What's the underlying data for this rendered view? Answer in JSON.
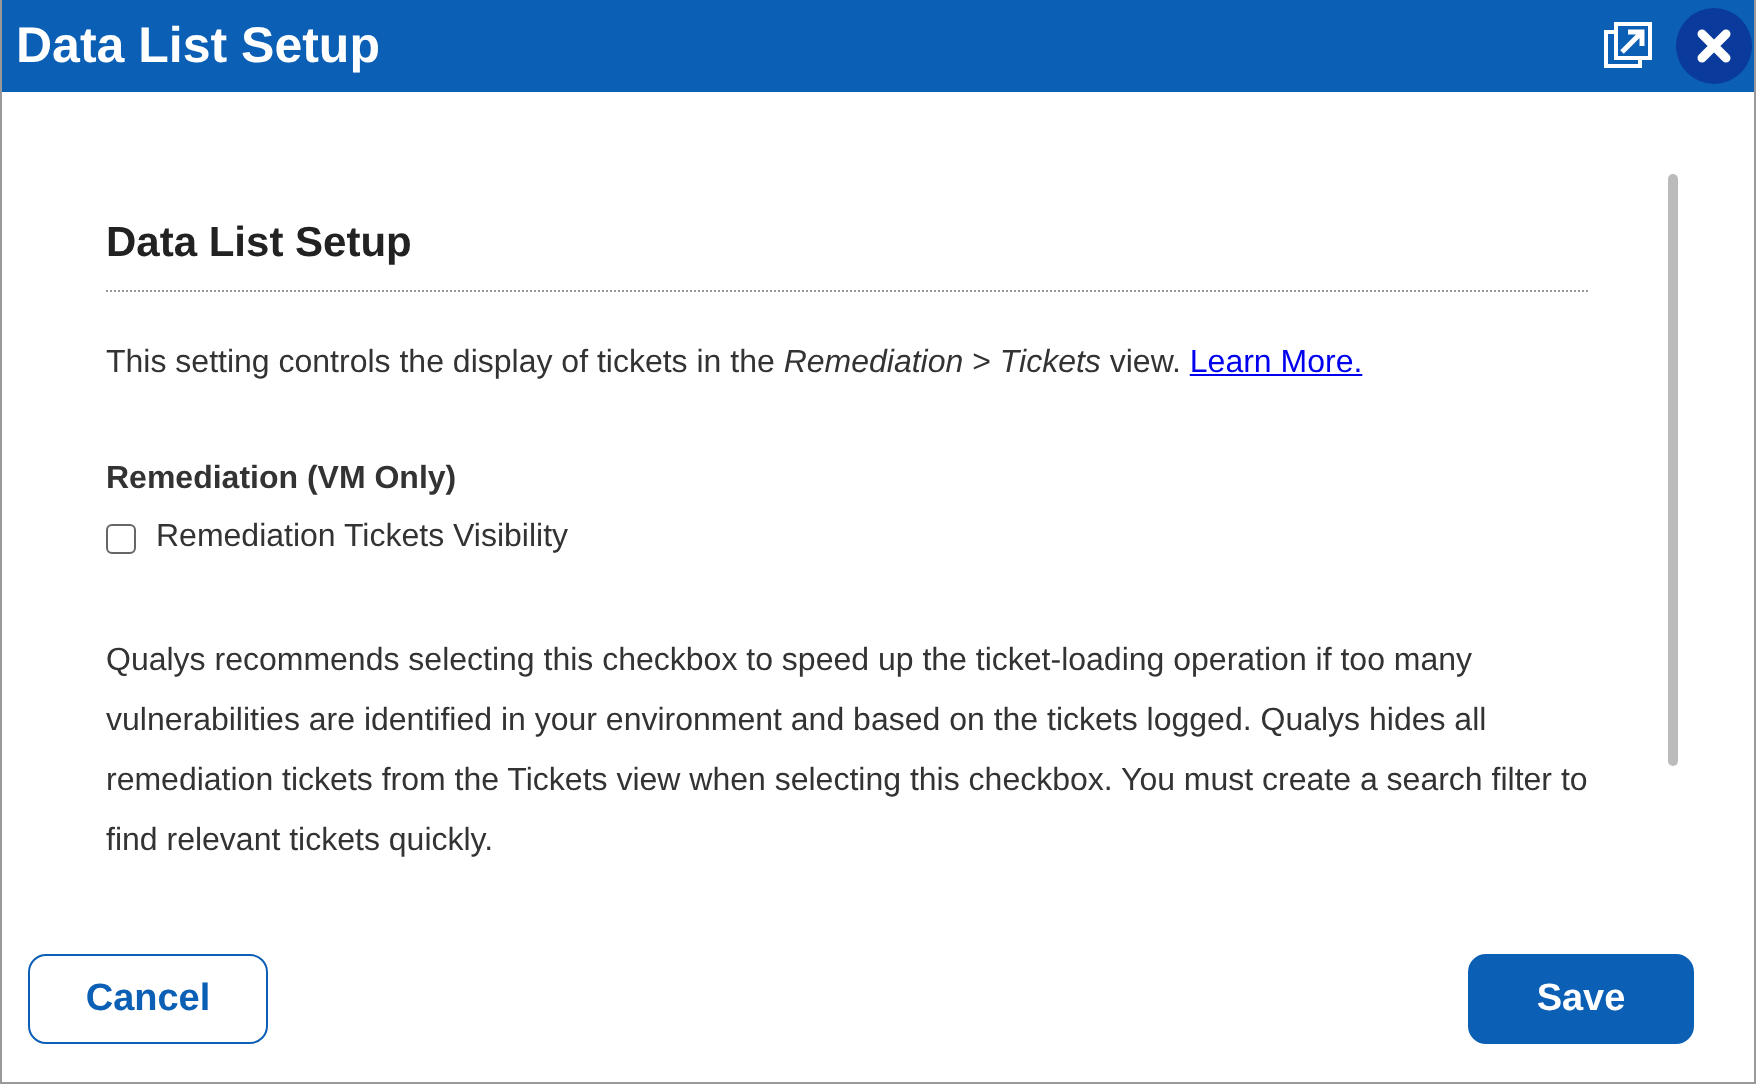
{
  "window": {
    "title": "Data List Setup"
  },
  "section": {
    "heading": "Data List Setup",
    "description": "This setting controls the display of tickets in the *Remediation* > *Tickets* view.",
    "link": "Learn More."
  },
  "group": {
    "label": "Remediation (VM Only)",
    "checkbox": {
      "label": "Remediation Tickets Visibility",
      "checked": false
    }
  },
  "note": "Qualys recommends selecting this checkbox to speed up the ticket-loading operation if too many vulnerabilities are identified in your environment and based on the tickets logged. Qualys hides all remediation tickets from the Tickets view when selecting this checkbox. You must create a search filter to find relevant tickets quickly.",
  "buttons": [
    {
      "label": "Cancel",
      "kind": "secondary"
    },
    {
      "label": "Save",
      "kind": "primary"
    }
  ]
}
